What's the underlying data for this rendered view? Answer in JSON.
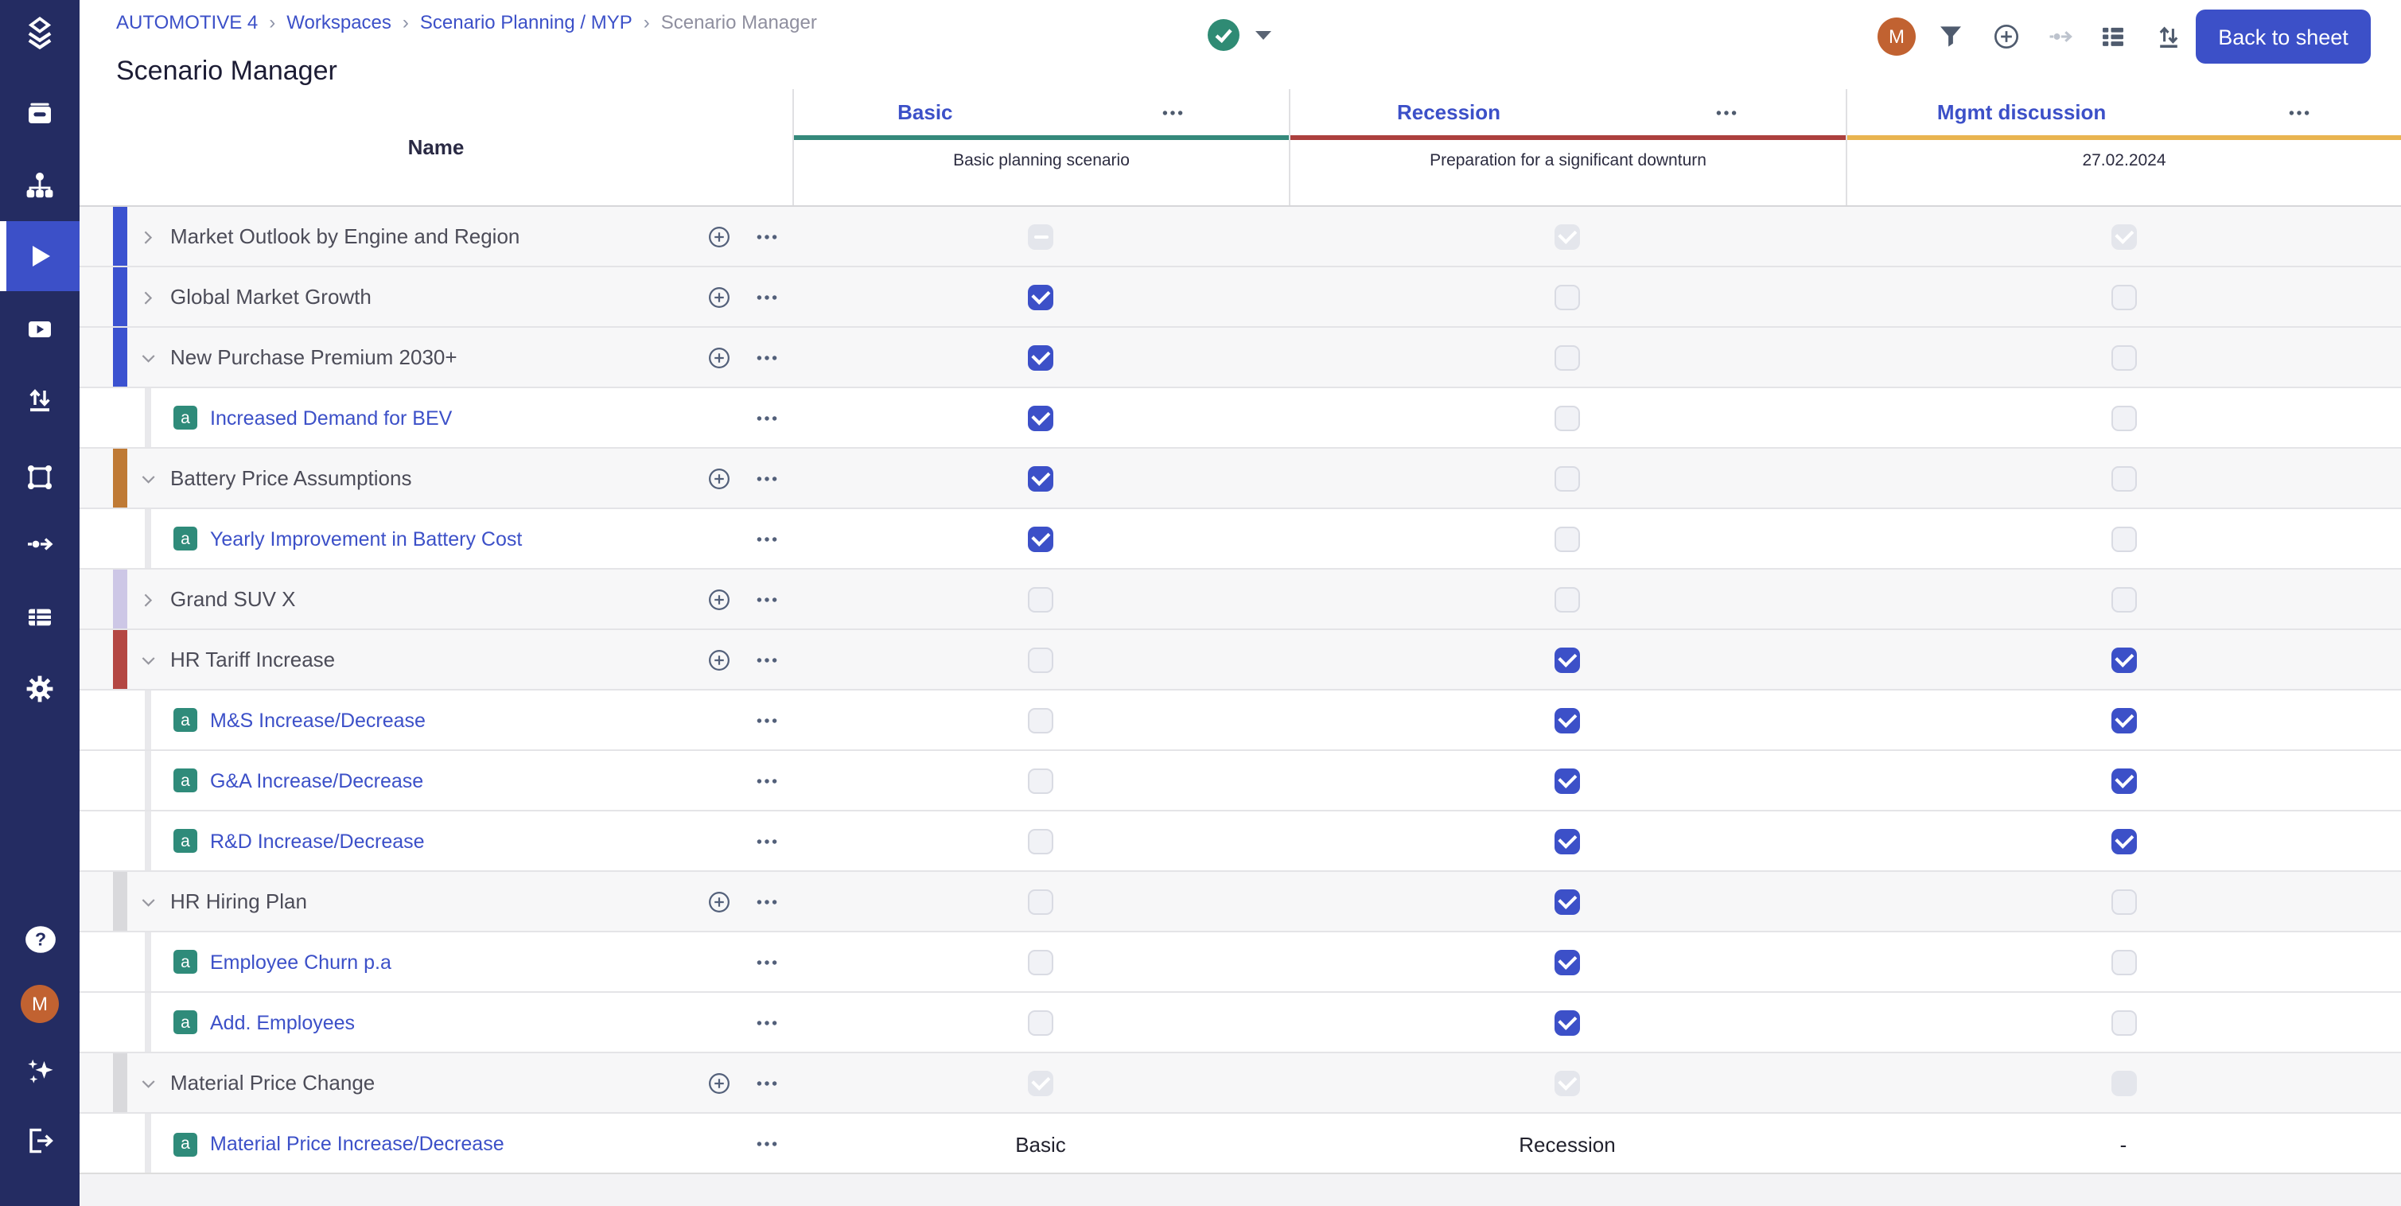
{
  "theme": {
    "primary": "#3c50c8",
    "green": "#2f8b74",
    "orange": "#c16231",
    "sidebar": "#242c62"
  },
  "user": {
    "initial": "M"
  },
  "breadcrumb": {
    "items": [
      "AUTOMOTIVE 4",
      "Workspaces",
      "Scenario Planning / MYP",
      "Scenario Manager"
    ],
    "separator": "›"
  },
  "page_title": "Scenario Manager",
  "topbar": {
    "back_button": "Back to sheet",
    "icons": [
      "status-check",
      "dropdown-caret",
      "avatar",
      "filter",
      "add-circle",
      "data-flow",
      "list-details",
      "sort",
      "back-to-sheet"
    ]
  },
  "sidebar": {
    "icons": [
      "app-logo",
      "archive",
      "hierarchy",
      "scenarios-active",
      "media-player",
      "import-export",
      "model-frame",
      "data-flow",
      "sheets",
      "settings",
      "help",
      "user-avatar",
      "ai-assistant",
      "logout"
    ]
  },
  "table": {
    "name_header": "Name",
    "assumption_badge": "a",
    "scenarios": [
      {
        "name": "Basic",
        "subtitle": "Basic planning scenario",
        "color": "#35897b"
      },
      {
        "name": "Recession",
        "subtitle": "Preparation for a significant downturn",
        "color": "#ac403e"
      },
      {
        "name": "Mgmt discussion",
        "subtitle": "27.02.2024",
        "color": "#e9b450"
      }
    ],
    "rows": [
      {
        "type": "group",
        "label": "Market Outlook by Engine and Region",
        "expanded": false,
        "accent": "#3b52d0",
        "cells": [
          "disabled-indeterminate",
          "disabled-checked",
          "disabled-checked"
        ]
      },
      {
        "type": "group",
        "label": "Global Market Growth",
        "expanded": false,
        "accent": "#3b52d0",
        "cells": [
          "checked",
          "unchecked",
          "unchecked"
        ]
      },
      {
        "type": "group",
        "label": "New Purchase Premium 2030+",
        "expanded": true,
        "accent": "#3b52d0",
        "cells": [
          "checked",
          "unchecked",
          "unchecked"
        ]
      },
      {
        "type": "child",
        "label": "Increased Demand for BEV",
        "cells": [
          "checked",
          "unchecked",
          "unchecked"
        ]
      },
      {
        "type": "group",
        "label": "Battery Price Assumptions",
        "expanded": true,
        "accent": "#bf7a35",
        "cells": [
          "checked",
          "unchecked",
          "unchecked"
        ]
      },
      {
        "type": "child",
        "label": "Yearly Improvement in Battery Cost",
        "cells": [
          "checked",
          "unchecked",
          "unchecked"
        ]
      },
      {
        "type": "group",
        "label": "Grand SUV X",
        "expanded": false,
        "accent": "#cdc7e6",
        "cells": [
          "unchecked",
          "unchecked",
          "unchecked"
        ]
      },
      {
        "type": "group",
        "label": "HR Tariff Increase",
        "expanded": true,
        "accent": "#b44743",
        "cells": [
          "unchecked",
          "checked",
          "checked"
        ]
      },
      {
        "type": "child",
        "label": "M&S Increase/Decrease",
        "cells": [
          "unchecked",
          "checked",
          "checked"
        ]
      },
      {
        "type": "child",
        "label": "G&A Increase/Decrease",
        "cells": [
          "unchecked",
          "checked",
          "checked"
        ]
      },
      {
        "type": "child",
        "label": "R&D Increase/Decrease",
        "cells": [
          "unchecked",
          "checked",
          "checked"
        ]
      },
      {
        "type": "group",
        "label": "HR Hiring Plan",
        "expanded": true,
        "accent": "#d9d9dc",
        "cells": [
          "unchecked",
          "checked",
          "unchecked"
        ]
      },
      {
        "type": "child",
        "label": "Employee Churn p.a",
        "cells": [
          "unchecked",
          "checked",
          "unchecked"
        ]
      },
      {
        "type": "child",
        "label": "Add. Employees",
        "cells": [
          "unchecked",
          "checked",
          "unchecked"
        ]
      },
      {
        "type": "group",
        "label": "Material Price Change",
        "expanded": true,
        "accent": "#d9d9dc",
        "cells": [
          "disabled-checked",
          "disabled-checked",
          "disabled-empty"
        ]
      },
      {
        "type": "child",
        "label": "Material Price Increase/Decrease",
        "cells": [
          "text:Basic",
          "text:Recession",
          "text:-"
        ]
      }
    ]
  }
}
